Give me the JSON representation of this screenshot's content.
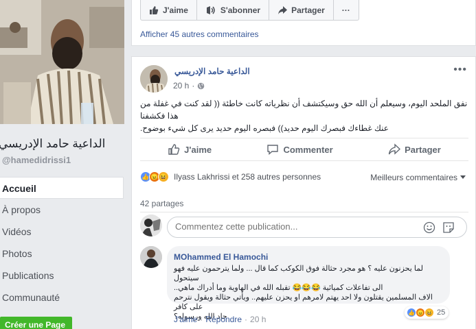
{
  "sidebar": {
    "page_name": "الداعية حامد الإدريسي",
    "handle": "@hamedidrissi1",
    "items": [
      {
        "label": "Accueil",
        "active": true
      },
      {
        "label": "À propos"
      },
      {
        "label": "Vidéos"
      },
      {
        "label": "Photos"
      },
      {
        "label": "Publications"
      },
      {
        "label": "Communauté"
      }
    ],
    "create_page_label": "Créer une Page"
  },
  "page_actions": {
    "like_label": "J'aime",
    "subscribe_label": "S'abonner",
    "share_label": "Partager",
    "more_label": "···",
    "more_comments_link": "Afficher 45 autres commentaires"
  },
  "post": {
    "author": "الداعية حامد الإدريسي",
    "time": "20 h",
    "privacy_icon": "globe-icon",
    "text_line_1": "نفق الملحد اليوم، وسيعلم أن الله حق وسيكتشف أن نظرياته كانت خاطئة (( لقد كنت في غفلة من هذا فكشفنا",
    "text_line_2": "عنك غطاءك فبصرك اليوم حديد)) فبصره اليوم حديد يرى كل شيء بوضوح.",
    "actions": {
      "like": "J'aime",
      "comment": "Commenter",
      "share": "Partager"
    },
    "reactions_text": "Ilyass Lakhrissi et 258 autres personnes",
    "sort_label": "Meilleurs commentaires",
    "shares_text": "42 partages",
    "composer_placeholder": "Commentez cette publication..."
  },
  "comment": {
    "author": "MOhammed El Hamochi",
    "line_1": "لما يحزنون عليه ؟ هو مجرد حثالة فوق الكوكب كما قال ... ولما يترحمون عليه فهو سيتحول",
    "line_2": "الى تفاعلات كميائية 😂😂😂 تقبله الله في الهاوية وما أدراك ماهي..",
    "line_3": "الاف المسلمين يقتلون ولا احد يهتم لامرهم او يحزن عليهم.. ويأتي حثالة ويقول نترحم على كافر",
    "line_4": "حاد الله ورسوله؟",
    "like_label": "J'aime",
    "reply_label": "Répondre",
    "time": "20 h",
    "reaction_count": "25"
  },
  "colors": {
    "brand_link": "#385898",
    "background": "#e9ebee",
    "create_button": "#42b72a",
    "like_blue": "#5890ff",
    "angry_red": "#e9710f",
    "haha_yellow": "#f7b125"
  }
}
